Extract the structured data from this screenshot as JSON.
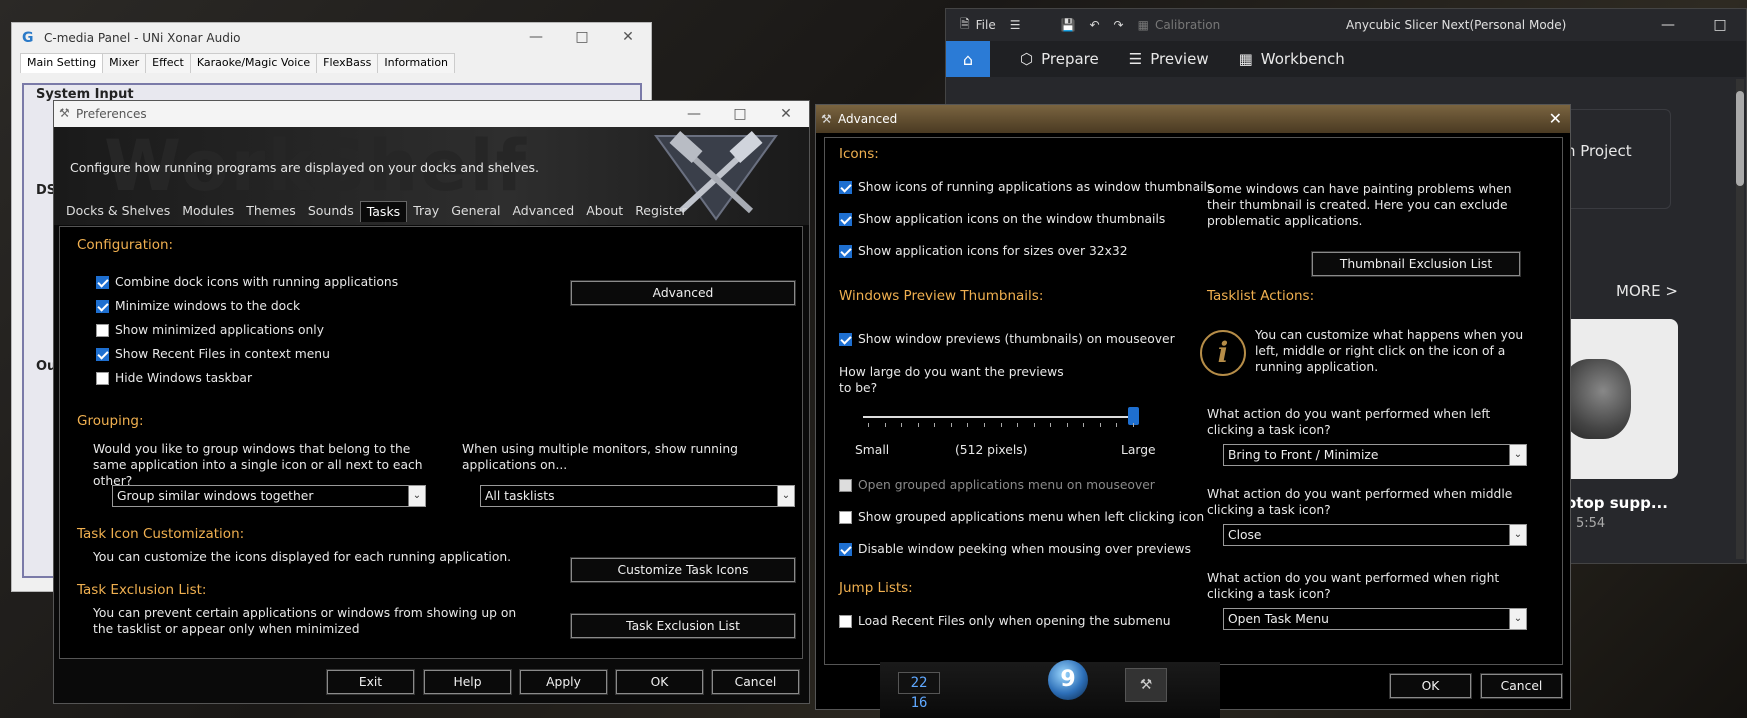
{
  "cmedia": {
    "title": "C-media Panel - UNi Xonar Audio",
    "tabs": [
      "Main Setting",
      "Mixer",
      "Effect",
      "Karaoke/Magic Voice",
      "FlexBass",
      "Information"
    ],
    "section1": "System Input",
    "section2": "DS",
    "section3": "Ou"
  },
  "anycubic": {
    "file": "File",
    "calibration": "Calibration",
    "title": "Anycubic Slicer Next(Personal Mode)",
    "nav": [
      "Prepare",
      "Preview",
      "Workbench"
    ],
    "project_partial": "n Project",
    "more": "MORE >",
    "model_title": "otop supp...",
    "model_time": "5:54"
  },
  "prefs": {
    "title": "Preferences",
    "description": "Configure how running programs are displayed on your docks and shelves.",
    "watermark": "WorkShelf",
    "tabs": [
      "Docks & Shelves",
      "Modules",
      "Themes",
      "Sounds",
      "Tasks",
      "Tray",
      "General",
      "Advanced",
      "About",
      "Register"
    ],
    "active_tab": "Tasks",
    "config_title": "Configuration:",
    "checks": [
      {
        "label": "Combine dock icons with running applications",
        "checked": true
      },
      {
        "label": "Minimize windows to the dock",
        "checked": true
      },
      {
        "label": "Show minimized applications only",
        "checked": false
      },
      {
        "label": "Show Recent Files in context menu",
        "checked": true
      },
      {
        "label": "Hide Windows taskbar",
        "checked": false
      }
    ],
    "advanced_btn": "Advanced",
    "grouping_title": "Grouping:",
    "grouping_q": "Would you like to group windows that belong to the same application into a single icon or all next to each other?",
    "grouping_value": "Group similar windows together",
    "monitors_q": "When using multiple monitors, show running applications on...",
    "monitors_value": "All tasklists",
    "icon_title": "Task Icon Customization:",
    "icon_text": "You can customize the icons displayed for each running application.",
    "icon_btn": "Customize Task Icons",
    "excl_title": "Task Exclusion List:",
    "excl_text": "You can prevent certain applications or windows from showing up on the tasklist or appear only when minimized",
    "excl_btn": "Task Exclusion List",
    "buttons": [
      "Exit",
      "Help",
      "Apply",
      "OK",
      "Cancel"
    ]
  },
  "adv": {
    "title": "Advanced",
    "icons_title": "Icons:",
    "icon_checks": [
      {
        "label": "Show icons of running applications as window thumbnails",
        "checked": true
      },
      {
        "label": "Show application icons on the window thumbnails",
        "checked": true
      },
      {
        "label": "Show application icons for sizes over 32x32",
        "checked": true
      }
    ],
    "thumb_text": "Some windows can have painting problems when their thumbnail is created. Here you can exclude problematic applications.",
    "thumb_btn": "Thumbnail Exclusion List",
    "preview_title": "Windows Preview Thumbnails:",
    "preview_check": {
      "label": "Show window previews (thumbnails) on mouseover",
      "checked": true
    },
    "size_q": "How large do you want the previews to be?",
    "slider": {
      "min_label": "Small",
      "value_label": "(512 pixels)",
      "max_label": "Large",
      "fraction": 1.0
    },
    "group_checks": [
      {
        "label": "Open grouped applications menu on mouseover",
        "checked": false,
        "disabled": true
      },
      {
        "label": "Show grouped applications menu when left clicking icon",
        "checked": false
      },
      {
        "label": "Disable window peeking when mousing over previews",
        "checked": true
      }
    ],
    "jump_title": "Jump Lists:",
    "jump_check": {
      "label": "Load Recent Files only when opening the submenu",
      "checked": false
    },
    "tasklist_title": "Tasklist Actions:",
    "tasklist_text": "You can customize what happens when you left, middle or right click on the icon of a running application.",
    "left_q": "What action do you want performed when left clicking a task icon?",
    "left_value": "Bring to Front / Minimize",
    "middle_q": "What action do you want performed when middle clicking a task icon?",
    "middle_value": "Close",
    "right_q": "What action do you want performed when right clicking a task icon?",
    "right_value": "Open Task Menu",
    "ok": "OK",
    "cancel": "Cancel"
  },
  "dock": {
    "clock": "22 16"
  }
}
